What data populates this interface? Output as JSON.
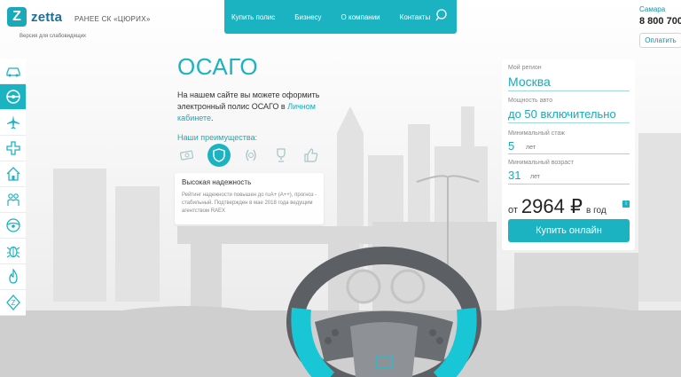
{
  "header": {
    "logo_letter": "Z",
    "brand": "zetta",
    "formerly": "РАНЕЕ СК «ЦЮРИХ»",
    "impaired": "Версия для слабовидящих",
    "nav": [
      "Купить полис",
      "Бизнесу",
      "О компании",
      "Контакты"
    ],
    "region": "Самара",
    "phone": "8 800 700",
    "pay_label": "Оплатить"
  },
  "sidebar": {
    "icons": [
      "car-icon",
      "steering-wheel-icon",
      "airplane-icon",
      "medical-cross-icon",
      "house-icon",
      "people-icon",
      "steering-icon",
      "bug-icon",
      "fire-icon",
      "zetta-z-icon"
    ],
    "active_index": 1
  },
  "main": {
    "title": "ОСАГО",
    "desc_text": "На нашем сайте вы можете оформить электронный полис ОСАГО в ",
    "desc_link": "Личном кабинете",
    "desc_end": ".",
    "advantages_label": "Наши преимущества:",
    "advantage_icons": [
      "money-icon",
      "shield-icon",
      "laurel-icon",
      "trophy-icon",
      "thumb-up-icon"
    ],
    "active_advantage": 1,
    "card_title": "Высокая надежность",
    "card_body": "Рейтинг надежности повышен до ruA+ (A++), прогноз - стабильный. Подтвержден в мае 2018 года ведущим агентством RAEX"
  },
  "form": {
    "region_label": "Мой регион",
    "region_value": "Москва",
    "power_label": "Мощность авто",
    "power_value": "до 50 включительно",
    "exp_label": "Минимальный стаж",
    "exp_value": "5",
    "exp_unit": "лет",
    "age_label": "Минимальный возраст",
    "age_value": "31",
    "age_unit": "лет",
    "price_prefix": "от",
    "price": "2964 ₽",
    "price_suffix": "в год",
    "info": "i",
    "buy_label": "Купить онлайн"
  },
  "colors": {
    "accent": "#1bb3c2",
    "accent_dark": "#1aa9b8",
    "brand": "#1a6f9a"
  }
}
